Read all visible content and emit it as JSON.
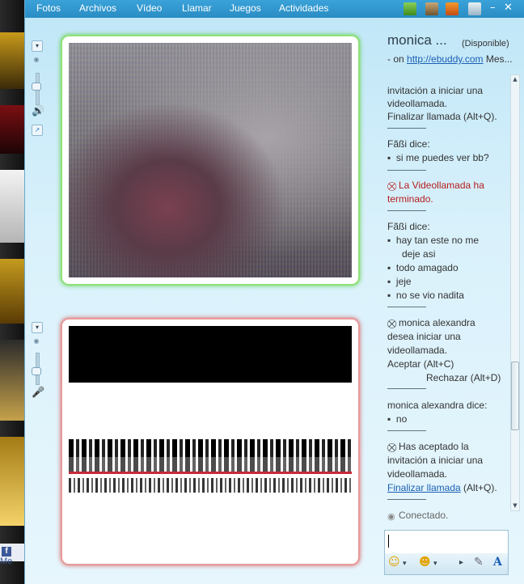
{
  "menu": [
    "Fotos",
    "Archivos",
    "Vídeo",
    "Llamar",
    "Juegos",
    "Actividades"
  ],
  "window_controls": {
    "minimize": "–",
    "maximize": "□",
    "close": "✕"
  },
  "contact": {
    "name": "monica ...",
    "status": "(Disponible)"
  },
  "personal_message": {
    "prefix": "- on ",
    "link": "http://ebuddy.com",
    "suffix": " Mes..."
  },
  "chat": {
    "l1": "invitación a iniciar una",
    "l2": "videollamada.",
    "l3": "Finalizar llamada (Alt+Q).",
    "s1_name": "Fãßi dice:",
    "s1_m1": "si me puedes ver bb?",
    "end1": "La Videollamada ha",
    "end2": "terminado.",
    "s2_name": "Fãßi dice:",
    "s2_m1": "hay tan este no me",
    "s2_m1b": "deje asi",
    "s2_m2": "todo amagado",
    "s2_m3": "jeje",
    "s2_m4": "no se vio nadita",
    "inv1": "monica alexandra",
    "inv2": "desea iniciar una",
    "inv3": "videollamada.",
    "accept": "Aceptar (Alt+C)",
    "reject": "Rechazar (Alt+D)",
    "s3_name": "monica alexandra dice:",
    "s3_m1": "no",
    "acc1": "Has aceptado la",
    "acc2": "invitación a iniciar una",
    "acc3": "videollamada.",
    "end_link": "Finalizar llamada",
    "end_key": " (Alt+Q).",
    "connected": "Conectado."
  },
  "sidebar_bg": {
    "fb_label": "Me"
  },
  "colors": {
    "menubar": "#2a8cc4",
    "frame_green": "#62cf4e",
    "frame_red": "#d46a6a",
    "system_red": "#b51d1d",
    "link": "#1a5fb4"
  }
}
